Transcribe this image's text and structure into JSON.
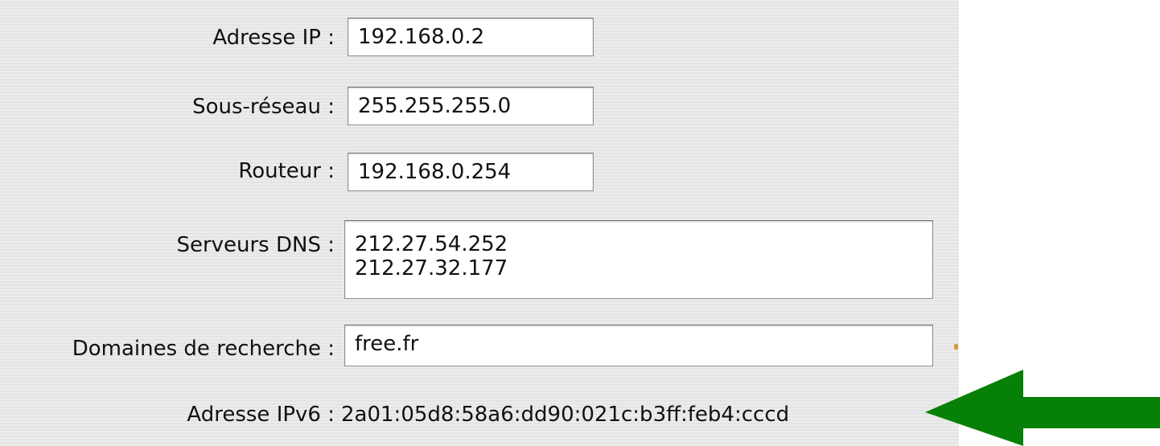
{
  "fields": {
    "ip_address": {
      "label": "Adresse IP :",
      "value": "192.168.0.2"
    },
    "subnet": {
      "label": "Sous-réseau :",
      "value": "255.255.255.0"
    },
    "router": {
      "label": "Routeur :",
      "value": "192.168.0.254"
    },
    "dns_servers": {
      "label": "Serveurs DNS :",
      "values": [
        "212.27.54.252",
        "212.27.32.177"
      ]
    },
    "search_domains": {
      "label": "Domaines de recherche :",
      "value": "free.fr"
    },
    "ipv6_address": {
      "label": "Adresse IPv6 :",
      "value": "2a01:05d8:58a6:dd90:021c:b3ff:feb4:cccd"
    }
  },
  "annotation": {
    "arrow_icon": "left-arrow-icon",
    "arrow_color": "#078007"
  },
  "colors": {
    "panel_background": "#e8e8e8",
    "field_background": "#ffffff"
  }
}
